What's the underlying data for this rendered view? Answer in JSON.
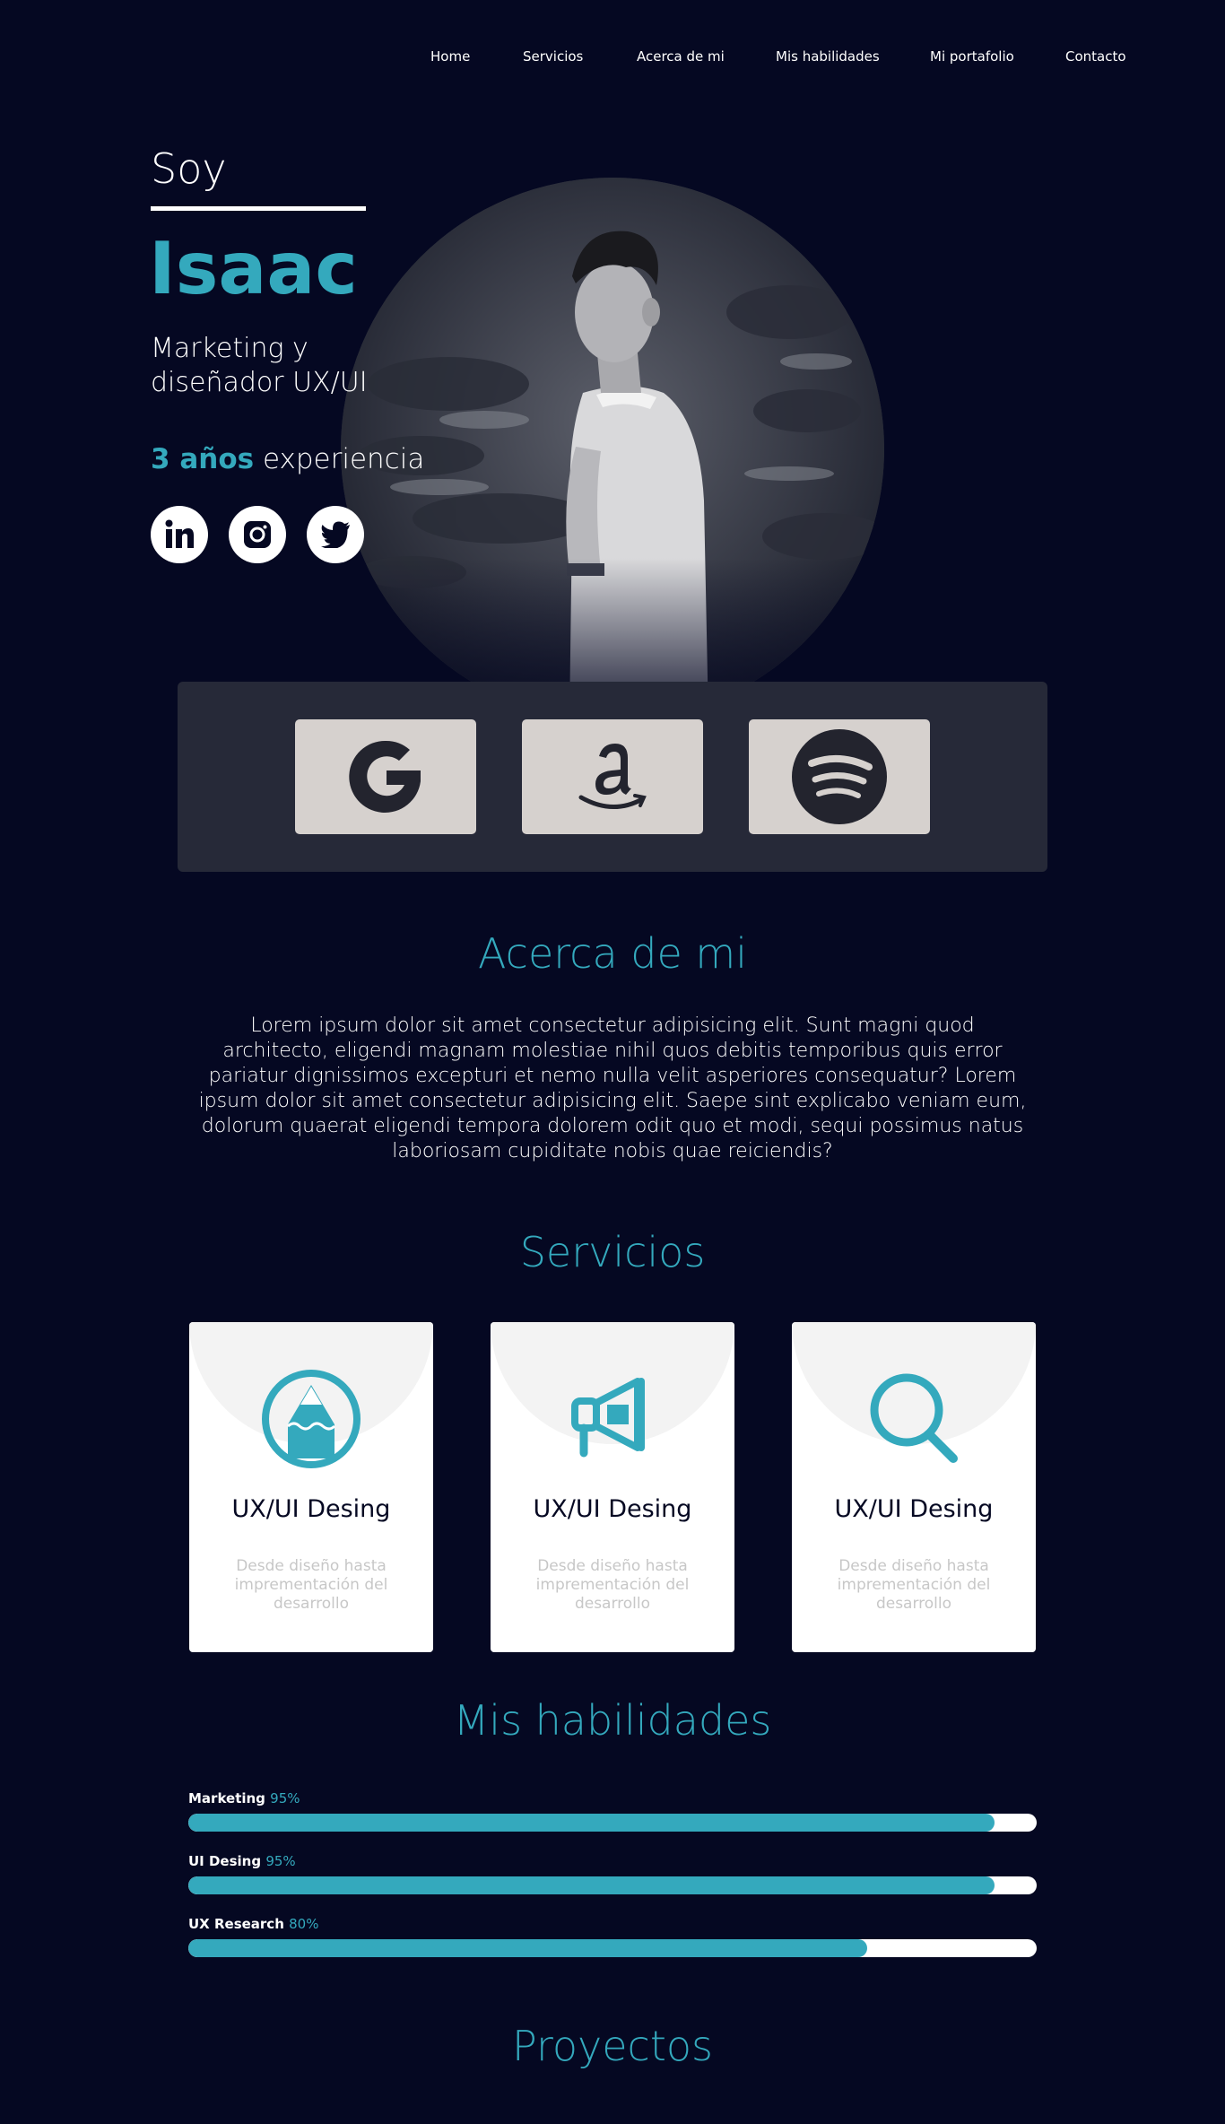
{
  "nav": {
    "items": [
      "Home",
      "Servicios",
      "Acerca de mi",
      "Mis habilidades",
      "Mi portafolio",
      "Contacto"
    ]
  },
  "hero": {
    "greeting": "Soy",
    "name": "Isaac",
    "role": "Marketing y diseñador UX/UI",
    "experience_years": "3 años",
    "experience_label": "experiencia",
    "socials": [
      "linkedin-icon",
      "instagram-icon",
      "twitter-icon"
    ]
  },
  "brands": [
    "google-logo",
    "amazon-logo",
    "spotify-logo"
  ],
  "about": {
    "title": "Acerca de mi",
    "text": "Lorem ipsum dolor sit amet consectetur adipisicing elit. Sunt magni quod architecto, eligendi magnam molestiae nihil quos debitis temporibus quis error pariatur dignissimos excepturi et nemo nulla velit asperiores consequatur? Lorem ipsum dolor sit amet consectetur adipisicing elit. Saepe sint explicabo veniam eum, dolorum quaerat eligendi tempora dolorem odit quo et modi, sequi possimus natus laboriosam cupiditate nobis quae reiciendis?"
  },
  "services": {
    "title": "Servicios",
    "cards": [
      {
        "icon": "pencil-icon",
        "title": "UX/UI Desing",
        "desc": "Desde diseño hasta imprementación del desarrollo"
      },
      {
        "icon": "megaphone-icon",
        "title": "UX/UI Desing",
        "desc": "Desde diseño hasta imprementación del desarrollo"
      },
      {
        "icon": "search-icon",
        "title": "UX/UI Desing",
        "desc": "Desde diseño hasta imprementación del desarrollo"
      }
    ]
  },
  "skills": {
    "title": "Mis habilidades",
    "items": [
      {
        "name": "Marketing",
        "percent_label": "95%",
        "value": 0.95
      },
      {
        "name": "UI Desing",
        "percent_label": "95%",
        "value": 0.95
      },
      {
        "name": "UX Research",
        "percent_label": "80%",
        "value": 0.8
      }
    ]
  },
  "projects": {
    "title": "Proyectos"
  },
  "colors": {
    "background": "#050822",
    "accent": "#34a9bd",
    "panel": "#262938",
    "brand_tile": "#d6d1ce"
  }
}
